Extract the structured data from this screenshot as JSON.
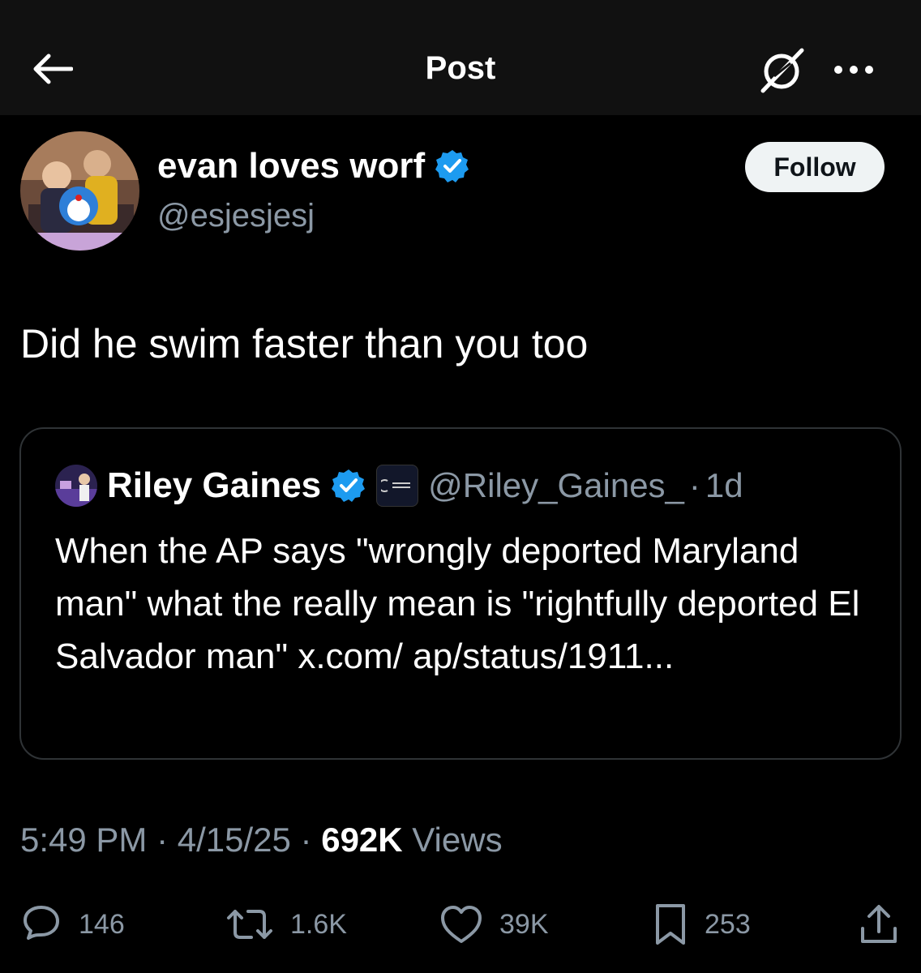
{
  "header": {
    "title": "Post"
  },
  "author": {
    "name": "evan loves worf",
    "handle": "@esjesjesj",
    "verified": true,
    "follow_label": "Follow"
  },
  "post": {
    "text": "Did he swim faster than you too"
  },
  "quote": {
    "name": "Riley Gaines",
    "handle": "@Riley_Gaines_",
    "separator": "·",
    "age": "1d",
    "verified": true,
    "text": "When the AP says \"wrongly deported Maryland man\" what the really mean is \"rightfully deported El Salvador man\" x.com/ ap/status/1911..."
  },
  "meta": {
    "time": "5:49 PM",
    "dot1": " · ",
    "date": "4/15/25",
    "dot2": " · ",
    "views_count": "692K",
    "views_label": " Views"
  },
  "actions": {
    "replies": "146",
    "reposts": "1.6K",
    "likes": "39K",
    "bookmarks": "253"
  },
  "colors": {
    "background": "#000000",
    "header_bg": "#111111",
    "verified": "#1d9bf0",
    "muted_text": "#8b98a5",
    "border": "#2f3336"
  },
  "icons": {
    "back": "arrow-left-icon",
    "grok": "grok-icon",
    "more": "more-horizontal-icon",
    "verified": "verified-badge-icon",
    "reply": "reply-icon",
    "repost": "repost-icon",
    "like": "heart-icon",
    "bookmark": "bookmark-icon",
    "share": "share-icon"
  }
}
